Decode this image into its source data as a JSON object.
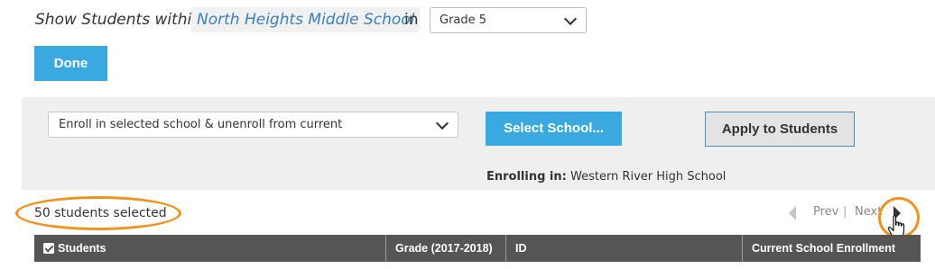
{
  "filter": {
    "show_label": "Show Students within",
    "school": "North Heights Middle School",
    "in_label": "in",
    "grade_value": "Grade 5"
  },
  "done_label": "Done",
  "action_panel": {
    "action_value": "Enroll in selected school & unenroll from current",
    "select_school_label": "Select School...",
    "apply_label": "Apply to Students",
    "enrolling_label": "Enrolling in:",
    "enrolling_school": "Western River High School"
  },
  "selection": {
    "count_text": "50 students selected"
  },
  "pager": {
    "prev_label": "Prev",
    "separator": "|",
    "next_label": "Next"
  },
  "table": {
    "columns": [
      "Students",
      "Grade (2017-2018)",
      "ID",
      "Current School Enrollment"
    ]
  },
  "colors": {
    "accent_blue": "#3aa9e0",
    "highlight_orange": "#f2921e",
    "header_grey": "#555555"
  },
  "icons": [
    "chevron-down-icon",
    "caret-left-icon",
    "caret-right-icon",
    "checkbox-icon",
    "hand-cursor-icon"
  ]
}
